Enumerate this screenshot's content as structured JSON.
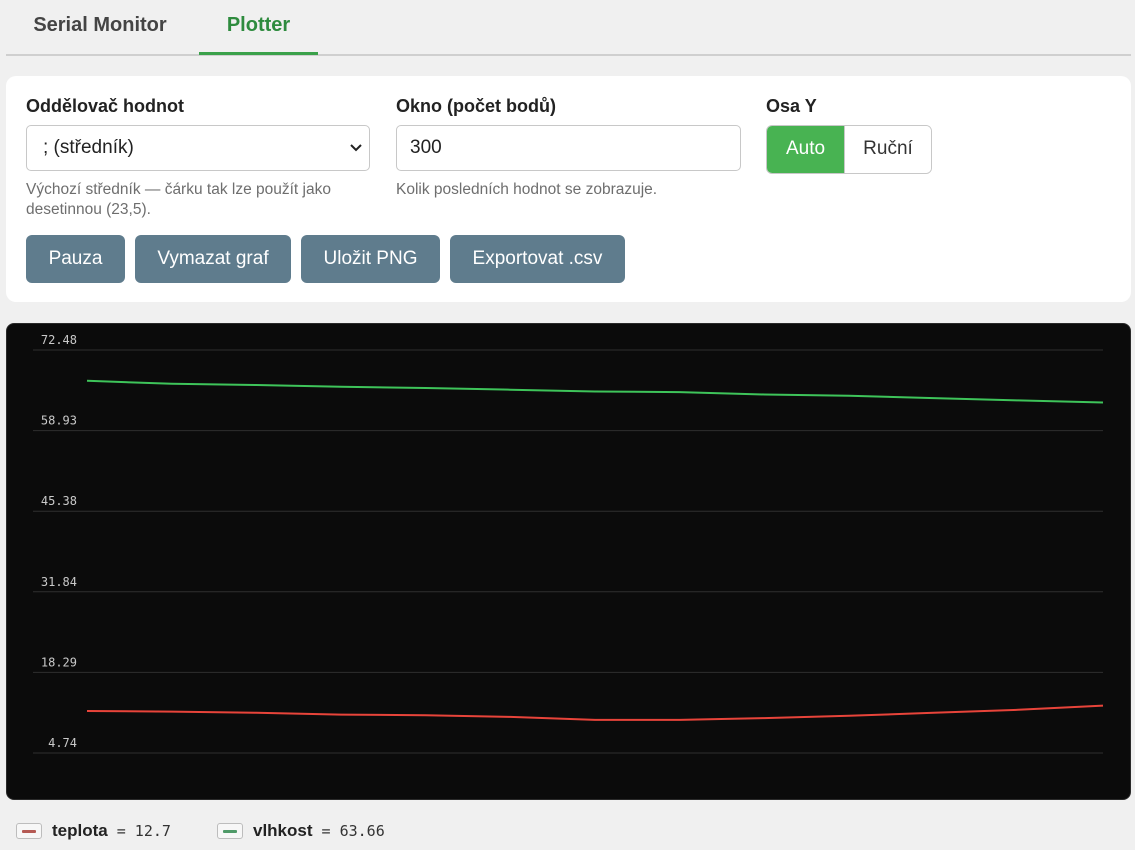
{
  "tabs": [
    {
      "label": "Serial Monitor",
      "active": false
    },
    {
      "label": "Plotter",
      "active": true
    }
  ],
  "settings": {
    "separator": {
      "label": "Oddělovač hodnot",
      "value": "; (středník)",
      "hint": "Výchozí středník — čárku tak lze použít jako desetinnou (23,5)."
    },
    "window": {
      "label": "Okno (počet bodů)",
      "value": "300",
      "hint": "Kolik posledních hodnot se zobrazuje."
    },
    "yaxis": {
      "label": "Osa Y",
      "auto_label": "Auto",
      "manual_label": "Ruční",
      "selected": "Auto"
    }
  },
  "buttons": {
    "pause": "Pauza",
    "clear": "Vymazat graf",
    "save_png": "Uložit PNG",
    "export_csv": "Exportovat .csv"
  },
  "colors": {
    "accent": "#48b352",
    "button": "#5f7c8d",
    "plot_bg": "#0b0b0b",
    "teplota": "#e8443a",
    "vlhkost": "#3ec45a"
  },
  "chart_data": {
    "type": "line",
    "ylim": [
      4.74,
      72.48
    ],
    "yticks": [
      "72.48",
      "58.93",
      "45.38",
      "31.84",
      "18.29",
      "4.74"
    ],
    "grid": true,
    "x": [
      0,
      25,
      50,
      75,
      100,
      125,
      150,
      175,
      200,
      225,
      250,
      275,
      300
    ],
    "series": [
      {
        "name": "teplota",
        "color": "#e8443a",
        "values": [
          11.8,
          11.7,
          11.5,
          11.2,
          11.1,
          10.8,
          10.3,
          10.3,
          10.6,
          11.0,
          11.5,
          12.0,
          12.7
        ]
      },
      {
        "name": "vlhkost",
        "color": "#3ec45a",
        "values": [
          67.3,
          66.8,
          66.6,
          66.3,
          66.1,
          65.8,
          65.5,
          65.4,
          65.0,
          64.8,
          64.4,
          64.0,
          63.66
        ]
      }
    ]
  },
  "legend": [
    {
      "name": "teplota",
      "value": "= 12.7"
    },
    {
      "name": "vlhkost",
      "value": "= 63.66"
    }
  ]
}
